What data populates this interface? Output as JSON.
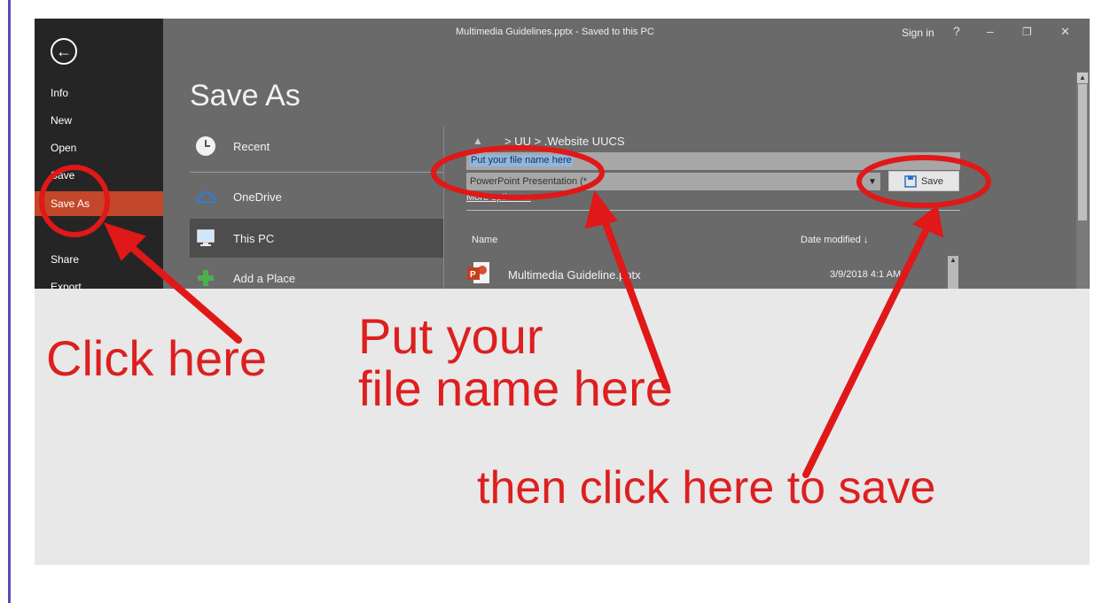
{
  "window": {
    "title": "Multimedia Guidelines.pptx  -  Saved to this PC",
    "sign_in": "Sign in",
    "help": "?",
    "minimize": "–",
    "restore": "❐",
    "close": "✕"
  },
  "nav": {
    "back_icon": "back-arrow-icon",
    "items": [
      {
        "label": "Info"
      },
      {
        "label": "New"
      },
      {
        "label": "Open"
      },
      {
        "label": "Save"
      },
      {
        "label": "Save As",
        "active": true
      },
      {
        "label": "Share"
      },
      {
        "label": "Export"
      }
    ]
  },
  "page_title": "Save As",
  "places": [
    {
      "label": "Recent",
      "icon": "clock-icon"
    },
    {
      "label": "OneDrive",
      "icon": "cloud-icon"
    },
    {
      "label": "This PC",
      "icon": "computer-icon",
      "active": true
    },
    {
      "label": "Add a Place",
      "icon": "plus-icon"
    }
  ],
  "save_panel": {
    "breadcrumb": "> UU > .Website  UUCS",
    "filename_placeholder": "Put your file name here",
    "filetype_value": "PowerPoint Presentation (*",
    "save_label": "Save",
    "more_options": "More options..."
  },
  "file_list": {
    "col_name": "Name",
    "col_date": "Date modified ↓",
    "files": [
      {
        "name": "Multimedia Guideline.pptx",
        "date": "3/9/2018 4:1 AM"
      }
    ]
  },
  "captions": {
    "click_here": "Click here",
    "put_name_line1": "Put your",
    "put_name_line2": "file name here",
    "then_save": "then click here to save"
  },
  "colors": {
    "accent_red": "#e01818",
    "nav_bg": "#252525",
    "active_nav": "#c3472a",
    "backstage_bg": "#6a6a6a"
  }
}
